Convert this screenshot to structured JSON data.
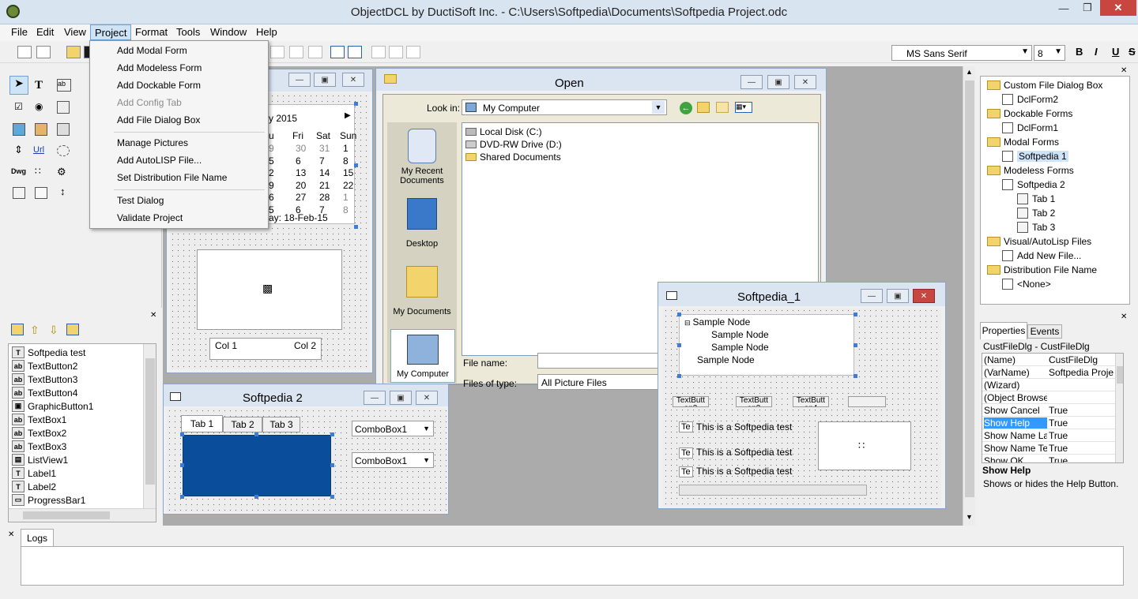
{
  "app": {
    "title": "ObjectDCL by DuctiSoft Inc. - C:\\Users\\Softpedia\\Documents\\Softpedia Project.odc"
  },
  "menu": [
    "File",
    "Edit",
    "View",
    "Project",
    "Format",
    "Tools",
    "Window",
    "Help"
  ],
  "project_menu": {
    "items": [
      "Add Modal Form",
      "Add Modeless Form",
      "Add Dockable Form",
      "Add Config Tab",
      "Add File Dialog Box",
      "Manage Pictures",
      "Add AutoLISP File...",
      "Set Distribution File Name",
      "Test Dialog",
      "Validate Project"
    ],
    "disabled": [
      "Add Config Tab"
    ]
  },
  "format_bar": {
    "font": "MS Sans Serif",
    "size": "8",
    "bold": "B",
    "italic": "I",
    "underline": "U"
  },
  "calendar": {
    "month": "y 2015",
    "days": [
      "u",
      "Fri",
      "Sat",
      "Sun"
    ],
    "rows": [
      [
        "9",
        "30",
        "31",
        "1"
      ],
      [
        "5",
        "6",
        "7",
        "8"
      ],
      [
        "2",
        "13",
        "14",
        "15"
      ],
      [
        "9",
        "20",
        "21",
        "22"
      ],
      [
        "6",
        "27",
        "28",
        "1"
      ],
      [
        "5",
        "6",
        "7",
        "8"
      ]
    ],
    "today": "ay: 18-Feb-15"
  },
  "grid": {
    "col1": "Col 1",
    "col2": "Col 2"
  },
  "control_list": [
    "Softpedia test",
    "TextButton2",
    "TextButton3",
    "TextButton4",
    "GraphicButton1",
    "TextBox1",
    "TextBox2",
    "TextBox3",
    "ListView1",
    "Label1",
    "Label2",
    "ProgressBar1"
  ],
  "control_icons": [
    "T",
    "ab",
    "ab",
    "ab",
    "▣",
    "ab",
    "ab",
    "ab",
    "▤",
    "T",
    "T",
    "▭"
  ],
  "softpedia2": {
    "title": "Softpedia 2",
    "tabs": [
      "Tab 1",
      "Tab 2",
      "Tab 3"
    ],
    "combo1": "ComboBox1",
    "combo2": "ComboBox1"
  },
  "open_dialog": {
    "title": "Open",
    "look_in_label": "Look in:",
    "look_in_value": "My Computer",
    "places": [
      "My Recent Documents",
      "Desktop",
      "My Documents",
      "My Computer"
    ],
    "files": [
      "Local Disk (C:)",
      "DVD-RW Drive (D:)",
      "Shared Documents"
    ],
    "file_name_label": "File name:",
    "file_type_label": "Files of type:",
    "file_type_value": "All Picture Files"
  },
  "softpedia1": {
    "title": "Softpedia_1",
    "tree_nodes": [
      "Sample Node",
      "Sample Node",
      "Sample Node",
      "Sample Node"
    ],
    "buttons": [
      "TextButt on2",
      "TextButt on3",
      "TextButt on4"
    ],
    "labels": [
      "This is a Softpedia test",
      "This is a Softpedia test",
      "This is a Softpedia test"
    ],
    "tags": [
      "Te",
      "Te",
      "Te"
    ]
  },
  "project_tree": [
    {
      "label": "Custom File Dialog Box",
      "type": "folder",
      "level": 0
    },
    {
      "label": "DclForm2",
      "type": "file",
      "level": 1
    },
    {
      "label": "Dockable Forms",
      "type": "folder",
      "level": 0
    },
    {
      "label": "DclForm1",
      "type": "file",
      "level": 1
    },
    {
      "label": "Modal Forms",
      "type": "folder",
      "level": 0
    },
    {
      "label": "Softpedia 1",
      "type": "file",
      "level": 1
    },
    {
      "label": "Modeless Forms",
      "type": "folder",
      "level": 0
    },
    {
      "label": "Softpedia 2",
      "type": "file",
      "level": 1
    },
    {
      "label": "Tab 1",
      "type": "tab",
      "level": 2
    },
    {
      "label": "Tab 2",
      "type": "tab",
      "level": 2
    },
    {
      "label": "Tab 3",
      "type": "tab",
      "level": 2
    },
    {
      "label": "Visual/AutoLisp Files",
      "type": "folder",
      "level": 0
    },
    {
      "label": "Add New File...",
      "type": "file",
      "level": 1
    },
    {
      "label": "Distribution File Name",
      "type": "folder",
      "level": 0
    },
    {
      "label": "<None>",
      "type": "file",
      "level": 1
    }
  ],
  "properties": {
    "tabs": [
      "Properties",
      "Events"
    ],
    "object": "CustFileDlg - CustFileDlg",
    "rows": [
      [
        "(Name)",
        "CustFileDlg"
      ],
      [
        "(VarName)",
        "Softpedia Projec"
      ],
      [
        "(Wizard)",
        ""
      ],
      [
        "(Object Browser)",
        ""
      ],
      [
        "Show Cancel",
        "True"
      ],
      [
        "Show Help",
        "True"
      ],
      [
        "Show Name Lab",
        "True"
      ],
      [
        "Show Name Tex",
        "True"
      ],
      [
        "Show OK",
        "True"
      ]
    ],
    "help_title": "Show Help",
    "help_text": "Shows or hides the Help Button."
  },
  "logs": {
    "tab": "Logs"
  }
}
